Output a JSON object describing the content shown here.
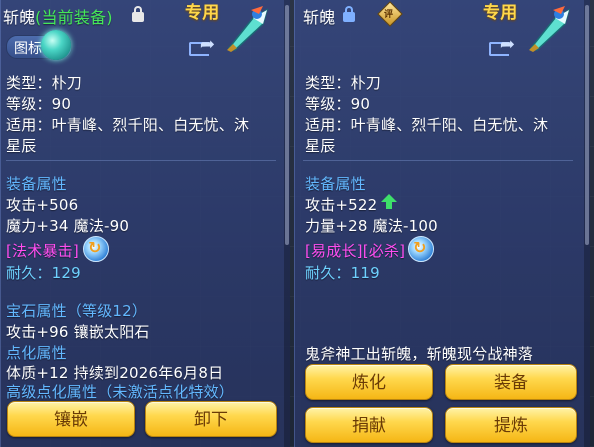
{
  "left_panel": {
    "name": "斩魄",
    "equipped_tag": "(当前装备)",
    "exclusive": "专用",
    "icon_toggle_label": "图标",
    "type_line": "类型：朴刀",
    "level_line": "等级：90",
    "applicable_line1": "适用：叶青峰、烈千阳、白无忧、沐",
    "applicable_line2": "星辰",
    "equip_attr_header": "装备属性",
    "attack_line": "攻击+506",
    "magic_line": "魔力+34 魔法-90",
    "skill_label": "[法术暴击]",
    "durability": "耐久：129",
    "gem_header": "宝石属性（等级12）",
    "gem_line": "攻击+96 镶嵌太阳石",
    "enchant_header": "点化属性",
    "enchant_line": "体质+12 持续到2026年6月8日",
    "advanced_enchant": "高级点化属性（未激活点化特效）",
    "buttons": {
      "inlay": "镶嵌",
      "unequip": "卸下"
    }
  },
  "right_panel": {
    "name": "斩魄",
    "exclusive": "专用",
    "badge_char": "评",
    "type_line": "类型：朴刀",
    "level_line": "等级：90",
    "applicable_line1": "适用：叶青峰、烈千阳、白无忧、沐",
    "applicable_line2": "星辰",
    "equip_attr_header": "装备属性",
    "attack_line": "攻击+522",
    "strength_line": "力量+28 魔法-100",
    "skill_label": "[易成长][必杀]",
    "durability": "耐久：119",
    "flavor_text": "鬼斧神工出斩魄，斩魄现兮战神落",
    "buttons": {
      "refine": "炼化",
      "equip": "装备",
      "donate": "捐献",
      "extract": "提炼"
    }
  },
  "colors": {
    "equipped": "#45e858",
    "exclusive": "#ffd84a",
    "section": "#63b8ff",
    "skill": "#ff4ef0",
    "button_text": "#6a3b06"
  },
  "icons": [
    "lock-icon",
    "share-icon",
    "weapon-icon",
    "skill-icon",
    "rating-badge-icon",
    "up-arrow-icon",
    "gem-orb-icon"
  ]
}
